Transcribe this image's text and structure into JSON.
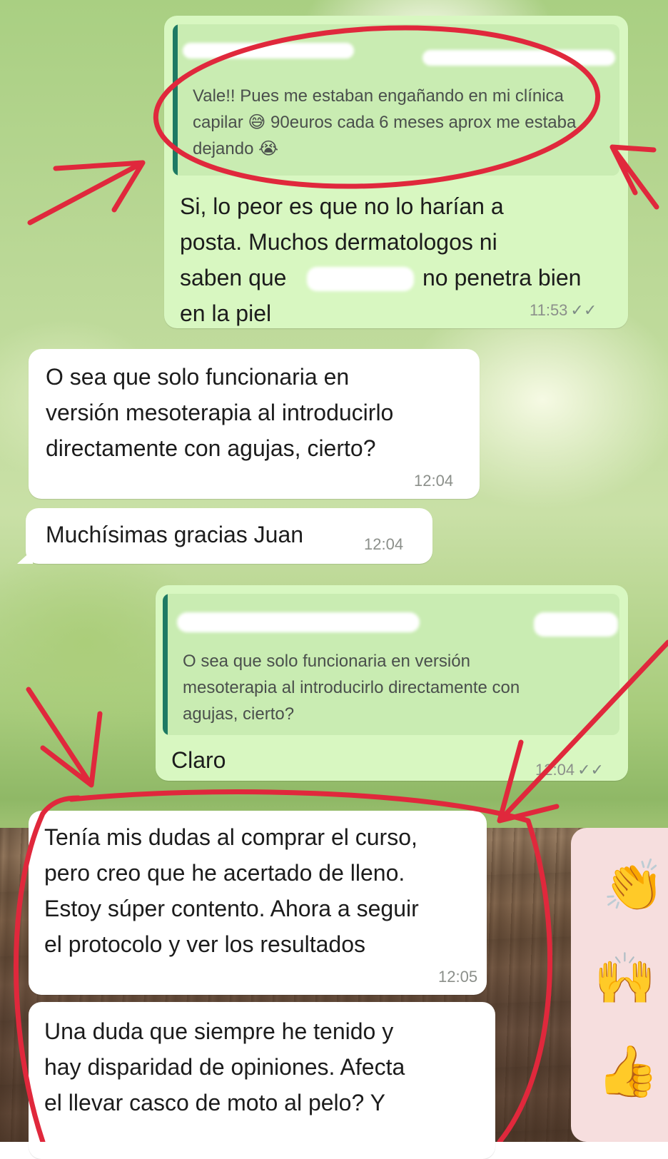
{
  "messages": {
    "m1": {
      "quote_text": "Vale!! Pues me estaban engañando en mi clínica capilar 😅 90euros cada 6 meses aprox me estaba dejando 😭",
      "line1": "Si, lo peor es que no lo harían a",
      "line2": "posta. Muchos dermatologos ni",
      "line3a": "saben que",
      "line3b": "no penetra bien",
      "line4": "en la piel",
      "time": "11:53",
      "ticks": "✓✓"
    },
    "m2": {
      "line1": "O sea que solo funcionaria en",
      "line2": "versión mesoterapia al introducirlo",
      "line3": "directamente con agujas, cierto?",
      "time": "12:04"
    },
    "m3": {
      "text": "Muchísimas gracias Juan",
      "time": "12:04"
    },
    "m4": {
      "quote_line1": "O sea que solo funcionaria en versión",
      "quote_line2": "mesoterapia al introducirlo directamente con",
      "quote_line3": "agujas, cierto?",
      "text": "Claro",
      "time": "12:04",
      "ticks": "✓✓"
    },
    "m5": {
      "line1": "Tenía mis dudas al comprar el curso,",
      "line2": "pero creo que he acertado de lleno.",
      "line3": "Estoy súper contento. Ahora a seguir",
      "line4": "el protocolo y ver los resultados",
      "time": "12:05"
    },
    "m6": {
      "line1": "Una duda que siempre he tenido y",
      "line2": "hay disparidad de opiniones. Afecta",
      "line3": "el llevar casco de moto al pelo? Y"
    }
  },
  "emoji_panel": {
    "e1": "👏",
    "e2": "🙌",
    "e3": "👍"
  },
  "colors": {
    "outgoing_bubble": "#d8f7c1",
    "incoming_bubble": "#ffffff",
    "annotation_red": "#e0283c",
    "quote_bar": "#1e7a63"
  }
}
